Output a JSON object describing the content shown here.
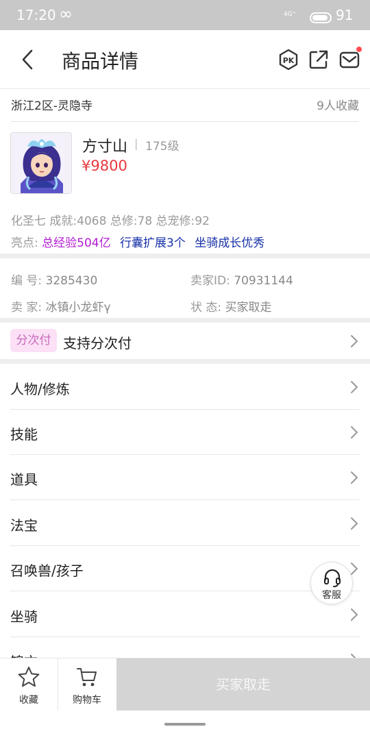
{
  "status_bar": {
    "time": "17:20",
    "infinity_glyph": "∞",
    "network_text": "4G⁺",
    "battery_level": "91"
  },
  "nav": {
    "title": "商品详情",
    "icons": [
      "back-arrow-icon",
      "pk-icon",
      "share-icon",
      "mail-icon"
    ]
  },
  "product": {
    "server": "浙江2区-灵隐寺",
    "favorites": "9人收藏",
    "role_name": "方寸山",
    "level": "175级",
    "price": "¥9800",
    "stats": "化圣七 成就:4068 总修:78 总宠修:92",
    "highlight_label": "亮点:",
    "highlights": [
      "总经验504亿",
      "行囊扩展3个",
      "坐骑成长优秀"
    ]
  },
  "info": {
    "id_label": "编  号:",
    "id_value": "3285430",
    "seller_id_label": "卖家ID:",
    "seller_id_value": "70931144",
    "seller_label": "卖  家:",
    "seller_value": "冰镇小龙虾γ",
    "status_label": "状  态:",
    "status_value": "买家取走"
  },
  "payment": {
    "badge": "分次付",
    "text": "支持分次付"
  },
  "menu": [
    {
      "label": "人物/修炼"
    },
    {
      "label": "技能"
    },
    {
      "label": "道具"
    },
    {
      "label": "法宝"
    },
    {
      "label": "召唤兽/孩子"
    },
    {
      "label": "坐骑"
    },
    {
      "label": "锦衣"
    }
  ],
  "customer_service": {
    "label": "客服"
  },
  "bottom_bar": {
    "favorite_label": "收藏",
    "cart_label": "购物车",
    "action_label": "买家取走"
  },
  "colors": {
    "price": "#e8383d",
    "highlight_purple": "#b31bd4",
    "highlight_blue": "#1630a8",
    "badge_bg": "#fbe0f6",
    "badge_text": "#c66ab9",
    "disabled_button": "#d4d4d4",
    "notification_dot": "#ff4d4f"
  }
}
